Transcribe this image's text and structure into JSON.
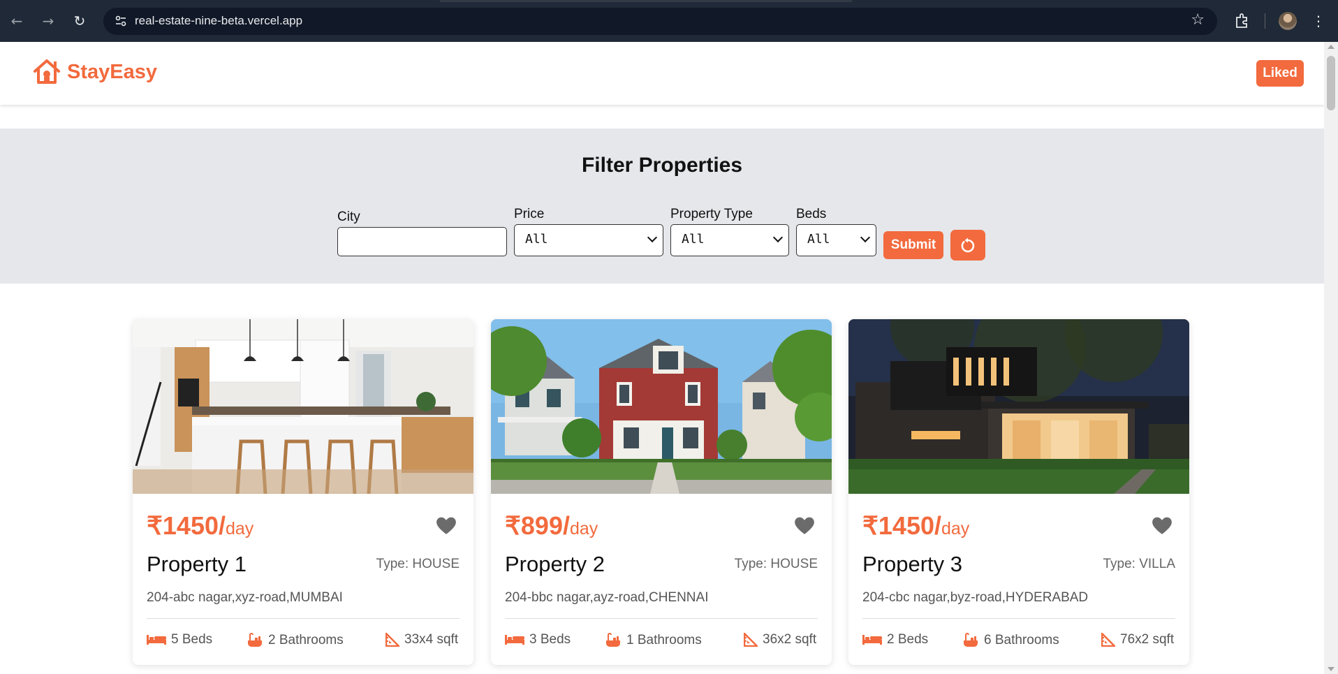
{
  "browser": {
    "url": "real-estate-nine-beta.vercel.app"
  },
  "navbar": {
    "brand": "StayEasy",
    "liked_label": "Liked",
    "accent_color": "#f26a3d"
  },
  "filter": {
    "heading": "Filter Properties",
    "city_label": "City",
    "city_value": "",
    "price_label": "Price",
    "price_value": "All",
    "type_label": "Property Type",
    "type_value": "All",
    "beds_label": "Beds",
    "beds_value": "All",
    "submit_label": "Submit",
    "reset_icon": "reset-icon"
  },
  "properties": [
    {
      "price": "₹1450/",
      "per": "day",
      "title": "Property 1",
      "type": "Type: HOUSE",
      "address": "204-abc nagar,xyz-road,MUMBAI",
      "beds": "5 Beds",
      "baths": "2 Bathrooms",
      "area": "33x4 sqft",
      "image": "kitchen-interior"
    },
    {
      "price": "₹899/",
      "per": "day",
      "title": "Property 2",
      "type": "Type: HOUSE",
      "address": "204-bbc nagar,ayz-road,CHENNAI",
      "beds": "3 Beds",
      "baths": "1 Bathrooms",
      "area": "36x2 sqft",
      "image": "red-house"
    },
    {
      "price": "₹1450/",
      "per": "day",
      "title": "Property 3",
      "type": "Type: VILLA",
      "address": "204-cbc nagar,byz-road,HYDERABAD",
      "beds": "2 Beds",
      "baths": "6 Bathrooms",
      "area": "76x2 sqft",
      "image": "modern-villa"
    }
  ]
}
